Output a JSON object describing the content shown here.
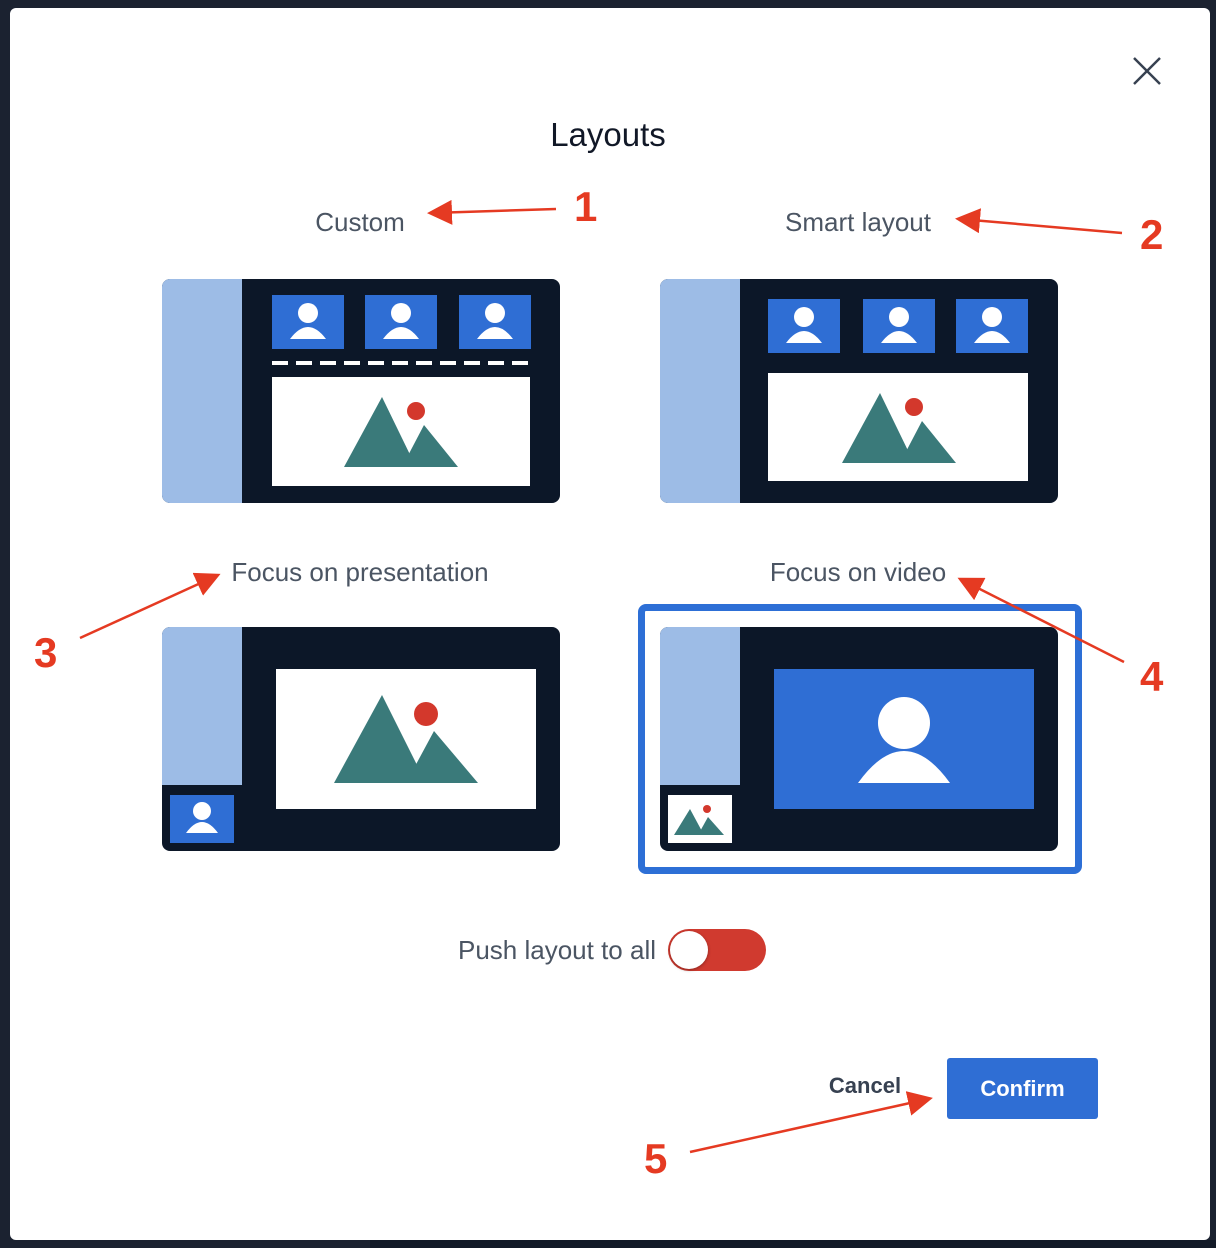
{
  "dialog": {
    "title": "Layouts",
    "close_icon": "close-icon"
  },
  "layouts": [
    {
      "id": "custom",
      "label": "Custom"
    },
    {
      "id": "smart",
      "label": "Smart layout"
    },
    {
      "id": "presentation",
      "label": "Focus on presentation"
    },
    {
      "id": "video",
      "label": "Focus on video",
      "selected": true
    }
  ],
  "push_layout": {
    "label": "Push layout to all",
    "enabled": true
  },
  "actions": {
    "cancel_label": "Cancel",
    "confirm_label": "Confirm"
  },
  "annotations": [
    "1",
    "2",
    "3",
    "4",
    "5"
  ],
  "colors": {
    "card_background": "#0c1728",
    "sidebar": "#9dbce6",
    "tile_blue": "#2f6ed4",
    "mountain": "#3a7a7a",
    "sun": "#d3382c",
    "selected_ring": "#2d6fd6",
    "toggle_on": "#d03a2f",
    "annotation_red": "#e53a22"
  }
}
